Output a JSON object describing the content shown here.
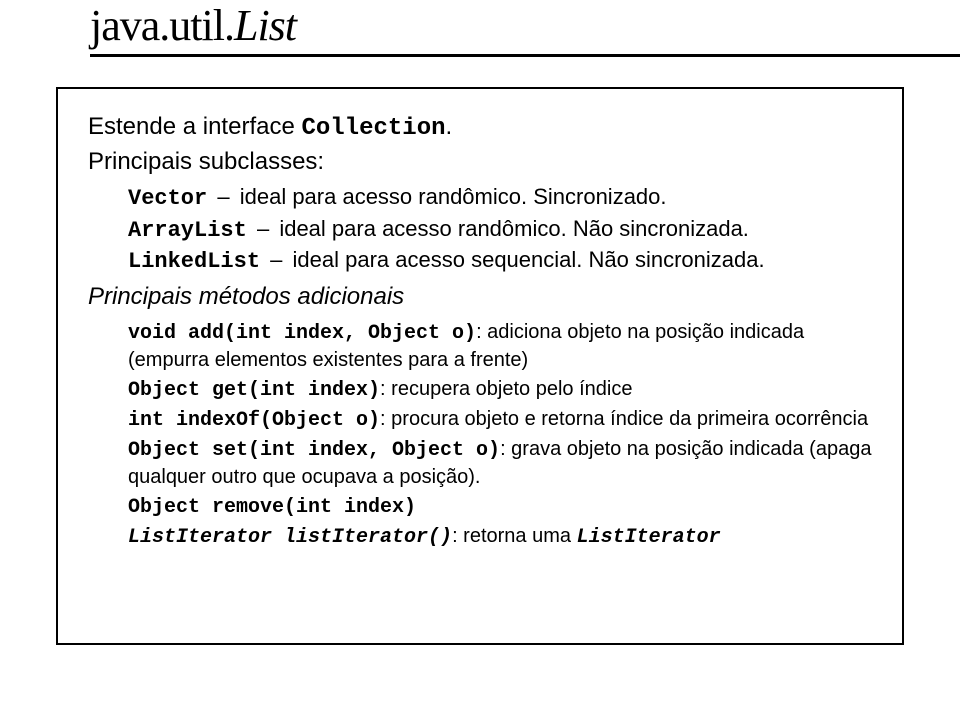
{
  "title": {
    "part1": "java.util.",
    "part2": "List"
  },
  "intro": {
    "prefix": "Estende a interface ",
    "class": "Collection",
    "suffix": "."
  },
  "subclasses_head": "Principais subclasses:",
  "subclasses": [
    {
      "cls": "Vector",
      "desc": "ideal para acesso randômico. Sincronizado."
    },
    {
      "cls": "ArrayList",
      "desc": "ideal para acesso randômico. Não sincronizada."
    },
    {
      "cls": "LinkedList",
      "desc": "ideal para acesso sequencial. Não sincronizada."
    }
  ],
  "methods_head": "Principais métodos adicionais",
  "methods": [
    {
      "sig": "void add(int index, Object o)",
      "desc": ": adiciona objeto na posição indicada (empurra elementos existentes para a frente)"
    },
    {
      "sig": "Object get(int index)",
      "desc": ": recupera objeto pelo índice"
    },
    {
      "sig": "int indexOf(Object o)",
      "desc": ": procura objeto e retorna índice da primeira ocorrência"
    },
    {
      "sig": "Object set(int index, Object o)",
      "desc": ": grava objeto na posição indicada (apaga qualquer outro que ocupava a posição)."
    },
    {
      "sig": "Object remove(int index)",
      "desc": ""
    }
  ],
  "last_line": {
    "sig": "ListIterator listIterator()",
    "mid": ": retorna uma ",
    "tail": "ListIterator"
  },
  "dash": "–"
}
